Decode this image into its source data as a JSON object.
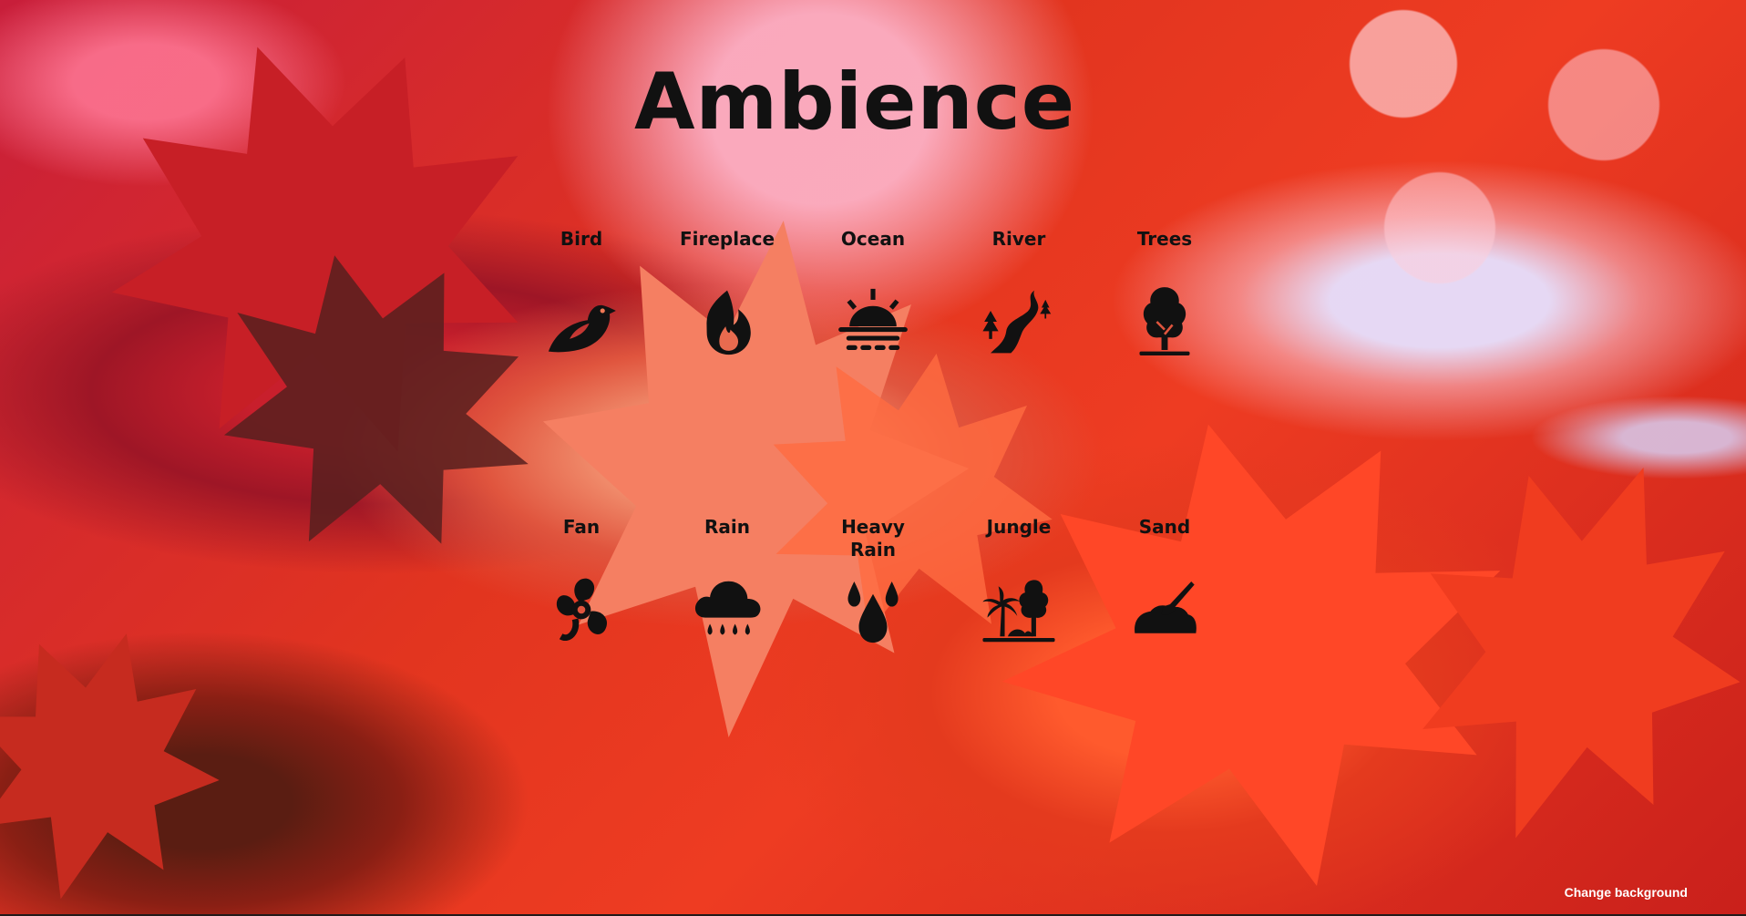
{
  "app": {
    "title": "Ambience"
  },
  "sounds": [
    {
      "label": "Bird",
      "icon": "bird-icon"
    },
    {
      "label": "Fireplace",
      "icon": "fire-icon"
    },
    {
      "label": "Ocean",
      "icon": "sunset-water-icon"
    },
    {
      "label": "River",
      "icon": "river-icon"
    },
    {
      "label": "Trees",
      "icon": "tree-icon"
    },
    {
      "label": "Fan",
      "icon": "fan-icon"
    },
    {
      "label": "Rain",
      "icon": "cloud-rain-icon"
    },
    {
      "label": "Heavy Rain",
      "icon": "droplets-icon"
    },
    {
      "label": "Jungle",
      "icon": "jungle-icon"
    },
    {
      "label": "Sand",
      "icon": "sand-shovel-icon"
    }
  ],
  "footer": {
    "change_background": "Change background"
  },
  "colors": {
    "text": "#111111",
    "background_primary": "#e2351f",
    "background_highlight": "#e6e1ff"
  }
}
